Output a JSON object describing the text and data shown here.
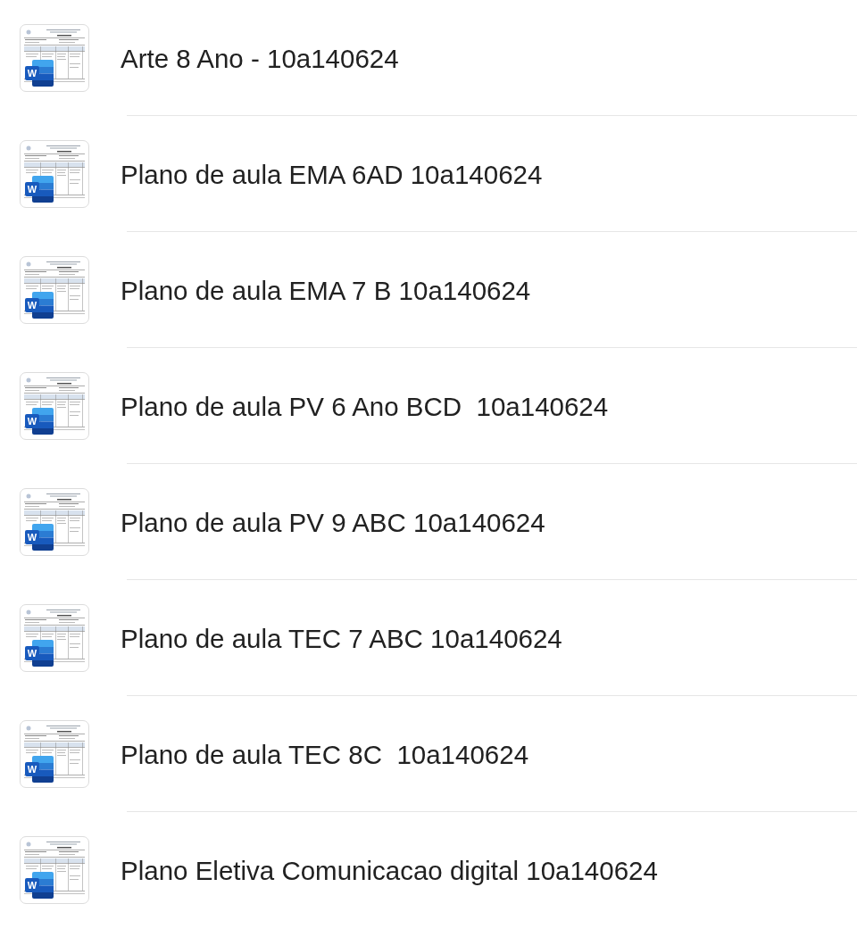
{
  "files": [
    {
      "name": "Arte 8 Ano - 10a140624",
      "app_badge": "W"
    },
    {
      "name": "Plano de aula EMA 6AD 10a140624",
      "app_badge": "W"
    },
    {
      "name": "Plano de aula EMA 7 B 10a140624",
      "app_badge": "W"
    },
    {
      "name": "Plano de aula PV 6 Ano BCD  10a140624",
      "app_badge": "W"
    },
    {
      "name": "Plano de aula PV 9 ABC 10a140624",
      "app_badge": "W"
    },
    {
      "name": "Plano de aula TEC 7 ABC 10a140624",
      "app_badge": "W"
    },
    {
      "name": "Plano de aula TEC 8C  10a140624",
      "app_badge": "W"
    },
    {
      "name": "Plano Eletiva Comunicacao digital 10a140624",
      "app_badge": "W"
    }
  ]
}
